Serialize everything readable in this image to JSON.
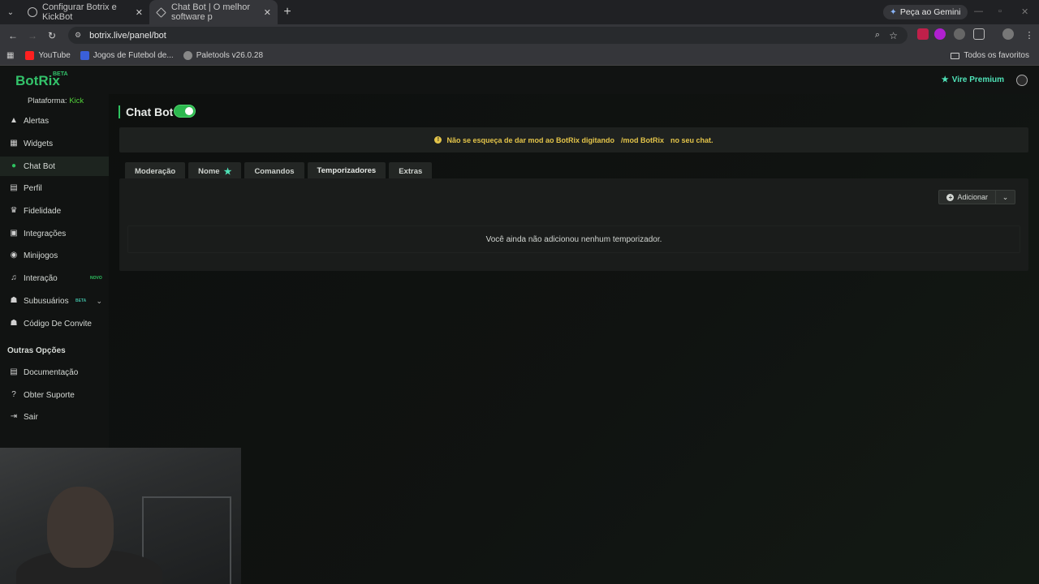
{
  "browser": {
    "tabs": [
      {
        "title": "Configurar Botrix e KickBot",
        "active": false
      },
      {
        "title": "Chat Bot | O melhor software p",
        "active": true
      }
    ],
    "new_tab_label": "+",
    "gemini_label": "Peça ao Gemini",
    "url": "botrix.live/panel/bot",
    "bookmarks": [
      {
        "label": "YouTube",
        "color": "#ff2020"
      },
      {
        "label": "Jogos de Futebol de...",
        "color": "#3a5fd9"
      },
      {
        "label": "Paletools v26.0.28",
        "color": "#888888"
      }
    ],
    "all_bookmarks_label": "Todos os favoritos"
  },
  "app": {
    "logo": "BotRix",
    "logo_badge": "BETA",
    "premium_label": "Vire Premium",
    "platform_label": "Plataforma:",
    "platform_value": "Kick",
    "nav": [
      {
        "label": "Alertas",
        "icon": "warning-icon",
        "glyph": "▲"
      },
      {
        "label": "Widgets",
        "icon": "grid-icon",
        "glyph": "▦"
      },
      {
        "label": "Chat Bot",
        "icon": "robot-icon",
        "glyph": "●",
        "active": true
      },
      {
        "label": "Perfil",
        "icon": "id-card-icon",
        "glyph": "▤"
      },
      {
        "label": "Fidelidade",
        "icon": "trophy-icon",
        "glyph": "♛"
      },
      {
        "label": "Integrações",
        "icon": "plug-icon",
        "glyph": "▣"
      },
      {
        "label": "Minijogos",
        "icon": "gamepad-icon",
        "glyph": "◉"
      },
      {
        "label": "Interação",
        "icon": "music-icon",
        "glyph": "♫",
        "badge": "NOVO"
      },
      {
        "label": "Subusuários",
        "icon": "users-icon",
        "glyph": "☗",
        "badge": "BETA",
        "chevron": "⌄"
      },
      {
        "label": "Código De Convite",
        "icon": "user-plus-icon",
        "glyph": "☗"
      }
    ],
    "other_options_title": "Outras Opções",
    "other_nav": [
      {
        "label": "Documentação",
        "icon": "document-icon",
        "glyph": "▤"
      },
      {
        "label": "Obter Suporte",
        "icon": "help-icon",
        "glyph": "?"
      },
      {
        "label": "Sair",
        "icon": "exit-icon",
        "glyph": "⇥"
      }
    ],
    "page_title": "Chat Bot",
    "notice": {
      "before": "Não se esqueça de dar mod ao BotRix digitando",
      "code": "/mod BotRix",
      "after": "no seu chat."
    },
    "tabs": [
      {
        "label": "Moderação"
      },
      {
        "label": "Nome",
        "star": true
      },
      {
        "label": "Comandos"
      },
      {
        "label": "Temporizadores",
        "active": true
      },
      {
        "label": "Extras"
      }
    ],
    "add_label": "Adicionar",
    "empty_message": "Você ainda não adicionou nenhum temporizador."
  },
  "colors": {
    "accent_green": "#2ec260",
    "notice_yellow": "#e3c44a",
    "premium_teal": "#4fe3b8"
  }
}
